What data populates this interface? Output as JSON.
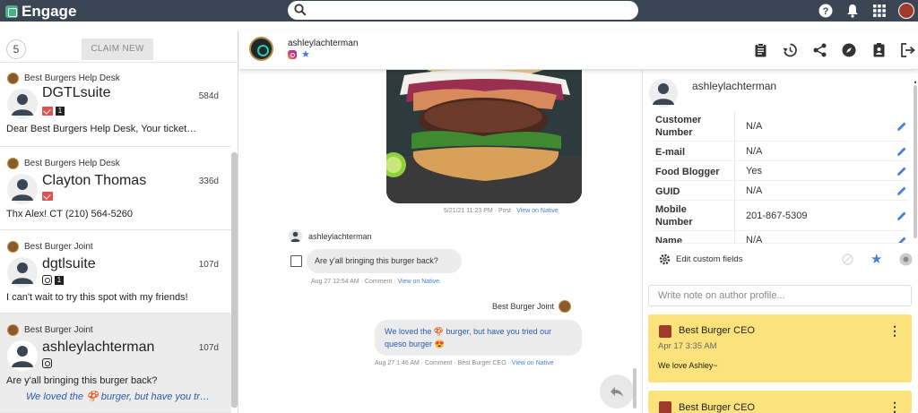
{
  "app": {
    "name": "Engage",
    "search_placeholder": ""
  },
  "queue": {
    "count": "5",
    "claim_label": "CLAIM NEW",
    "conversations": [
      {
        "brand": "Best Burgers Help Desk",
        "name": "DGTLsuite",
        "age": "584d",
        "badge": "1",
        "preview": "Dear Best Burgers Help Desk, Your ticket…",
        "channel": "email"
      },
      {
        "brand": "Best Burgers Help Desk",
        "name": "Clayton Thomas",
        "age": "336d",
        "badge": "",
        "preview": "Thx Alex! CT (210) 564-5260",
        "channel": "email"
      },
      {
        "brand": "Best Burger Joint",
        "name": "dgtlsuite",
        "age": "107d",
        "badge": "1",
        "preview": "I can't wait to try this spot with my friends!",
        "channel": "instagram"
      },
      {
        "brand": "Best Burger Joint",
        "name": "ashleylachterman",
        "age": "107d",
        "badge": "",
        "preview": "Are y'all bringing this burger back?",
        "preview2": "We loved the 🍄 burger, but have you tr…",
        "channel": "instagram"
      }
    ]
  },
  "conversation": {
    "author": "ashleylachterman",
    "post_meta": "5/21/21 11:23 PM · Post · ",
    "post_link": "View on Native",
    "comment_author": "ashleylachterman",
    "comment_text": "Are y'all bringing this burger back?",
    "comment_meta": "Aug 27 12:54 AM · Comment · ",
    "comment_link": "View on Native",
    "reply_brand": "Best Burger Joint",
    "reply_text": "We loved the 🍄 burger, but have you tried our queso burger 😍",
    "reply_meta": "Aug 27 1:46 AM · Comment · Best Burger CEO · ",
    "reply_link": "View on Native"
  },
  "profile": {
    "name": "ashleylachterman",
    "fields": [
      {
        "label": "Customer Number",
        "value": "N/A"
      },
      {
        "label": "E-mail",
        "value": "N/A"
      },
      {
        "label": "Food Blogger",
        "value": "Yes"
      },
      {
        "label": "GUID",
        "value": "N/A"
      },
      {
        "label": "Mobile Number",
        "value": "201-867-5309"
      },
      {
        "label": "Name",
        "value": "N/A"
      }
    ],
    "edit_custom_label": "Edit custom fields",
    "note_placeholder": "Write note on author profile...",
    "notes": [
      {
        "author": "Best Burger CEO",
        "date": "Apr 17 3:35 AM",
        "text": "We love Ashley~"
      },
      {
        "author": "Best Burger CEO",
        "date": "",
        "text": ""
      }
    ]
  },
  "colors": {
    "topbar": "#3b4654",
    "link": "#4a7fd6",
    "note": "#fbe27a",
    "email_badge": "#e05050"
  }
}
